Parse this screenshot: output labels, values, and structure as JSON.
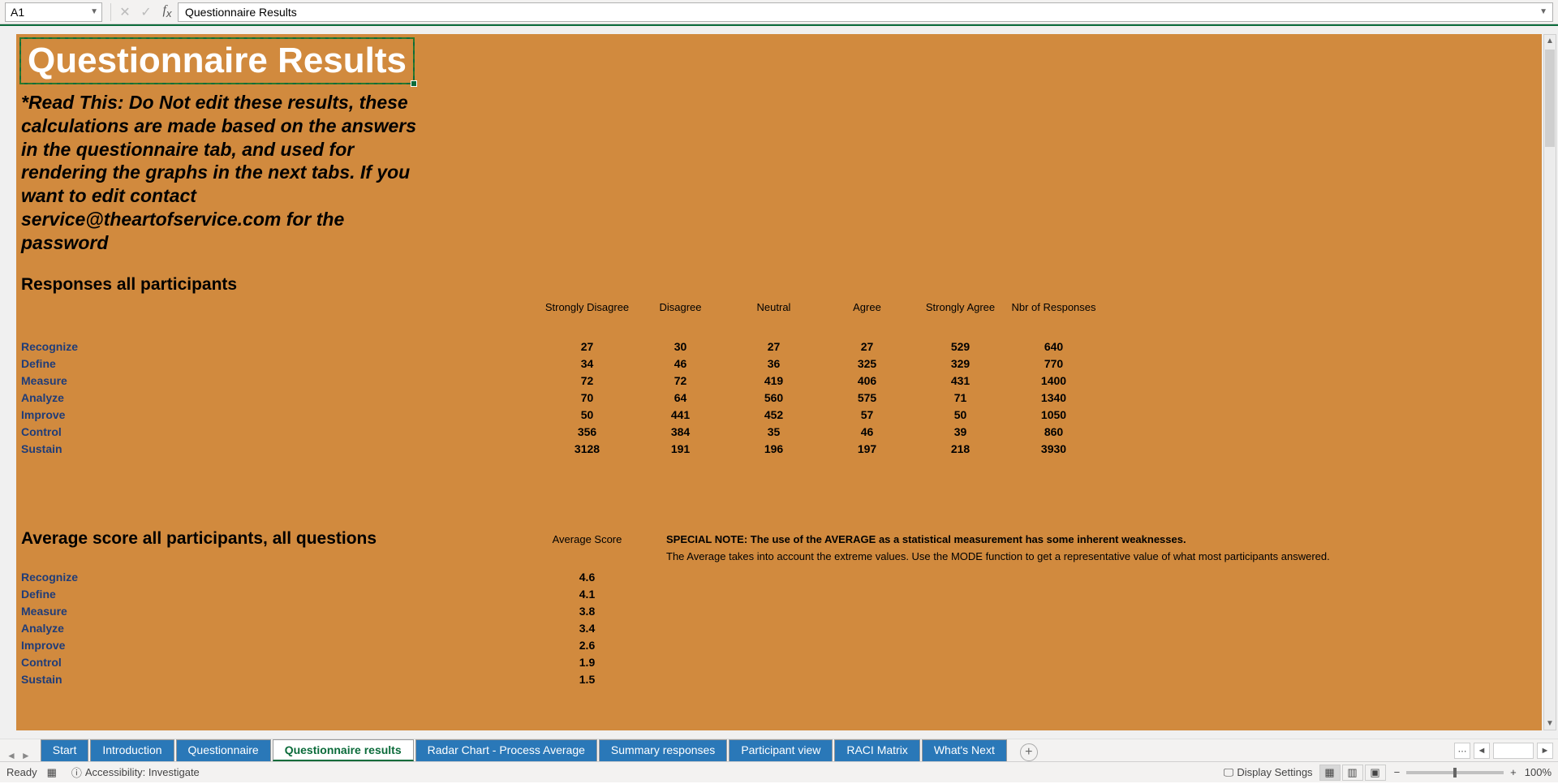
{
  "formula_bar": {
    "name_box": "A1",
    "formula": "Questionnaire Results"
  },
  "sheet": {
    "title": "Questionnaire Results",
    "warning": "*Read This: Do Not edit these results, these calculations are made based on the answers in the questionnaire tab, and used for rendering the graphs in the next tabs. If you want to edit contact service@theartofservice.com for the password",
    "section1_title": "Responses all participants",
    "section2_title": "Average score all participants, all questions",
    "avg_header": "Average Score",
    "special_note_bold": "SPECIAL NOTE: The use of the AVERAGE as a statistical measurement has some inherent weaknesses.",
    "special_note_text": "The Average takes into account the extreme values. Use the MODE function to get a representative value of what most participants answered."
  },
  "response_headers": [
    "Strongly Disagree",
    "Disagree",
    "Neutral",
    "Agree",
    "Strongly Agree",
    "Nbr of Responses"
  ],
  "chart_data": {
    "type": "table",
    "title": "Responses all participants",
    "columns": [
      "Category",
      "Strongly Disagree",
      "Disagree",
      "Neutral",
      "Agree",
      "Strongly Agree",
      "Nbr of Responses"
    ],
    "rows": [
      {
        "cat": "Recognize",
        "vals": [
          27,
          30,
          27,
          27,
          529,
          640
        ]
      },
      {
        "cat": "Define",
        "vals": [
          34,
          46,
          36,
          325,
          329,
          770
        ]
      },
      {
        "cat": "Measure",
        "vals": [
          72,
          72,
          419,
          406,
          431,
          1400
        ]
      },
      {
        "cat": "Analyze",
        "vals": [
          70,
          64,
          560,
          575,
          71,
          1340
        ]
      },
      {
        "cat": "Improve",
        "vals": [
          50,
          441,
          452,
          57,
          50,
          1050
        ]
      },
      {
        "cat": "Control",
        "vals": [
          356,
          384,
          35,
          46,
          39,
          860
        ]
      },
      {
        "cat": "Sustain",
        "vals": [
          3128,
          191,
          196,
          197,
          218,
          3930
        ]
      }
    ]
  },
  "avg_data": [
    {
      "cat": "Recognize",
      "val": "4.6"
    },
    {
      "cat": "Define",
      "val": "4.1"
    },
    {
      "cat": "Measure",
      "val": "3.8"
    },
    {
      "cat": "Analyze",
      "val": "3.4"
    },
    {
      "cat": "Improve",
      "val": "2.6"
    },
    {
      "cat": "Control",
      "val": "1.9"
    },
    {
      "cat": "Sustain",
      "val": "1.5"
    }
  ],
  "tabs": [
    {
      "label": "Start",
      "active": false
    },
    {
      "label": "Introduction",
      "active": false
    },
    {
      "label": "Questionnaire",
      "active": false
    },
    {
      "label": "Questionnaire results",
      "active": true
    },
    {
      "label": "Radar Chart - Process Average",
      "active": false
    },
    {
      "label": "Summary responses",
      "active": false
    },
    {
      "label": "Participant view",
      "active": false
    },
    {
      "label": "RACI Matrix",
      "active": false
    },
    {
      "label": "What's Next",
      "active": false
    }
  ],
  "status": {
    "ready": "Ready",
    "accessibility": "Accessibility: Investigate",
    "display_settings": "Display Settings",
    "zoom": "100%"
  }
}
